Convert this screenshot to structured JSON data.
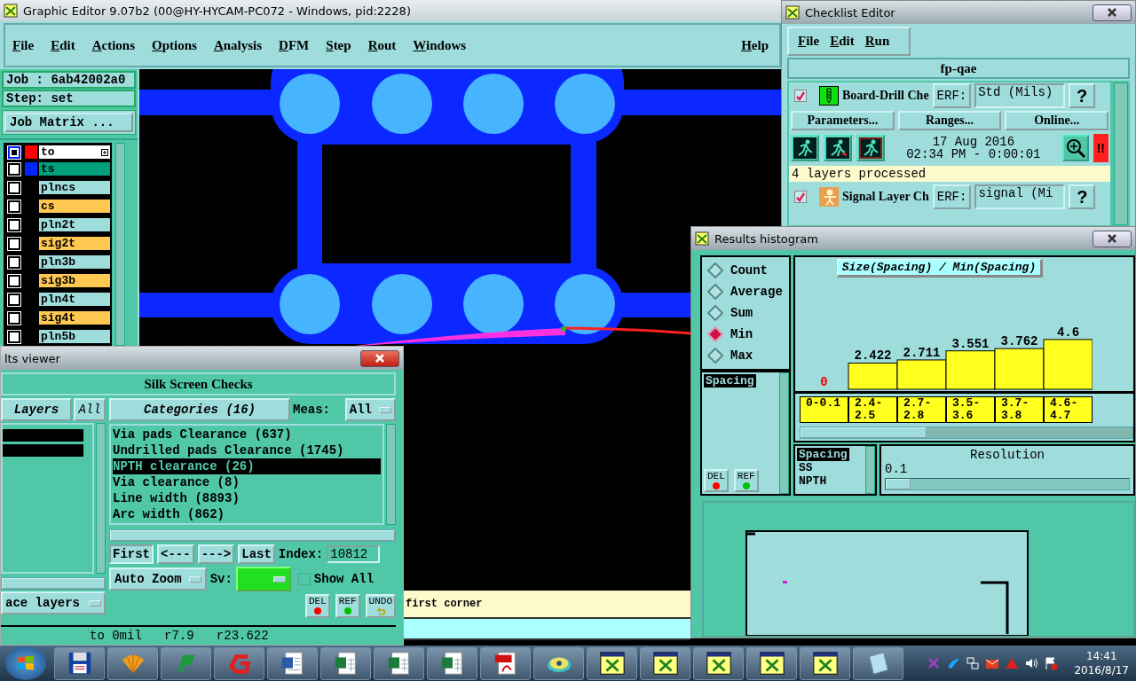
{
  "main_window": {
    "title": "Graphic Editor 9.07b2 (00@HY-HYCAM-PC072 - Windows, pid:2228)",
    "menu": [
      "File",
      "Edit",
      "Actions",
      "Options",
      "Analysis",
      "DFM",
      "Step",
      "Rout",
      "Windows"
    ],
    "help_menu": "Help",
    "job": "Job : 6ab42002a0",
    "step": "Step: set",
    "job_matrix_button": "Job Matrix ...",
    "layers": [
      {
        "name": "to",
        "kind": "silk",
        "color": "#ff0000",
        "selected": true
      },
      {
        "name": "ts",
        "kind": "mask",
        "color": "#0026ff",
        "selected": false
      },
      {
        "name": "plncs",
        "kind": "plane",
        "selected": false
      },
      {
        "name": "cs",
        "kind": "signal",
        "selected": false
      },
      {
        "name": "pln2t",
        "kind": "plane",
        "selected": false
      },
      {
        "name": "sig2t",
        "kind": "signal",
        "selected": false
      },
      {
        "name": "pln3b",
        "kind": "plane",
        "selected": false
      },
      {
        "name": "sig3b",
        "kind": "signal",
        "selected": false
      },
      {
        "name": "pln4t",
        "kind": "plane",
        "selected": false
      },
      {
        "name": "sig4t",
        "kind": "signal",
        "selected": false
      },
      {
        "name": "pln5b",
        "kind": "plane",
        "selected": false
      }
    ],
    "status": "first corner"
  },
  "checklist_editor": {
    "title": "Checklist Editor",
    "menu": [
      "File",
      "Edit",
      "Run"
    ],
    "checklist": "fp-qae",
    "checks": [
      {
        "kind": "drill",
        "name": "Board-Drill Che",
        "checked": true,
        "erf_label": "ERF:",
        "erf": "Std (Mils)",
        "help": "?",
        "buttons": [
          "Parameters...",
          "Ranges...",
          "Online..."
        ],
        "date": "17 Aug 2016",
        "time": "02:34 PM - 0:00:01",
        "alert": "!!",
        "message": "4 layers processed"
      },
      {
        "kind": "signal",
        "name": "Signal Layer Ch",
        "checked": true,
        "erf_label": "ERF:",
        "erf": "signal (Mi",
        "help": "?"
      }
    ]
  },
  "histogram": {
    "title": "Results histogram",
    "modes": [
      {
        "label": "Count",
        "selected": false
      },
      {
        "label": "Average",
        "selected": false
      },
      {
        "label": "Sum",
        "selected": false
      },
      {
        "label": "Min",
        "selected": true
      },
      {
        "label": "Max",
        "selected": false
      }
    ],
    "fields": [
      {
        "label": "Spacing",
        "selected": true
      }
    ],
    "tools": [
      "DEL",
      "REF"
    ],
    "chart_data": {
      "type": "bar",
      "title": "Size(Spacing) / Min(Spacing)",
      "categories": [
        "0-0.1",
        "2.4-2.5",
        "2.7-2.8",
        "3.5-3.6",
        "3.7-3.8",
        "4.6-4.7"
      ],
      "values": [
        0,
        2.422,
        2.711,
        3.551,
        3.762,
        4.6
      ],
      "data_labels": true
    },
    "lists": [
      {
        "label": "Spacing",
        "selected": true
      },
      {
        "label": "SS",
        "selected": false
      },
      {
        "label": "NPTH",
        "selected": false
      }
    ],
    "resolution": {
      "label": "Resolution",
      "value": "0.1",
      "level": 0
    }
  },
  "results_viewer": {
    "title": "lts viewer",
    "heading": "Silk Screen Checks",
    "layers_button": "Layers",
    "all_button": "All",
    "categories_button": "Categories (16)",
    "meas_label": "Meas:",
    "meas": "All",
    "categories": [
      {
        "label": "Via pads Clearance (637)",
        "selected": false
      },
      {
        "label": "Undrilled pads Clearance (1745)",
        "selected": false
      },
      {
        "label": "NPTH clearance (26)",
        "selected": true
      },
      {
        "label": "Via clearance (8)",
        "selected": false
      },
      {
        "label": "Line width (8893)",
        "selected": false
      },
      {
        "label": "Arc width (862)",
        "selected": false
      }
    ],
    "nav": [
      "First",
      "<---",
      "--->",
      "Last"
    ],
    "index_label": "Index:",
    "index": "10812",
    "zoom": "Auto Zoom",
    "sv_label": "Sv:",
    "show_all": {
      "label": "Show All",
      "checked": false
    },
    "layers_dropdown": "ace layers",
    "tools": [
      "DEL",
      "REF",
      "UNDO"
    ],
    "status": "to 0mil   r7.9   r23.622"
  },
  "taskbar": {
    "time": "14:41",
    "date": "2016/8/17"
  }
}
